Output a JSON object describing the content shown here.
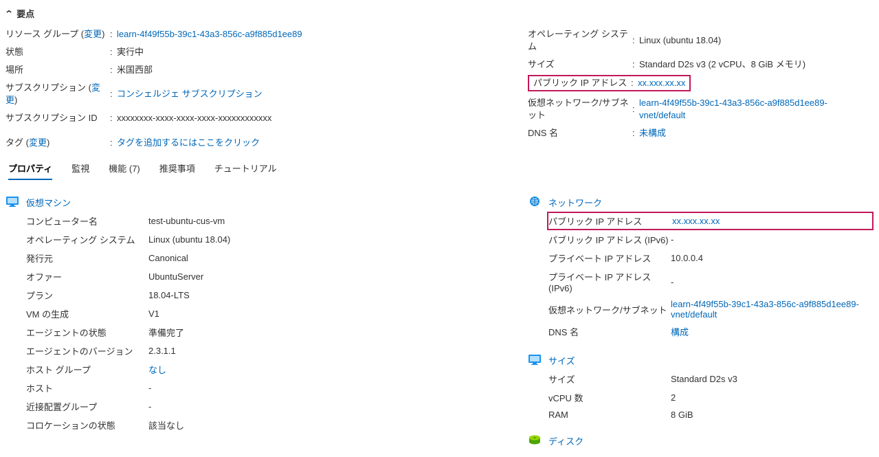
{
  "essentials_title": "要点",
  "change_text": "変更",
  "essentials": {
    "left": {
      "resource_group_label": "リソース グループ (",
      "resource_group_value": "learn-4f49f55b-39c1-43a3-856c-a9f885d1ee89",
      "status_label": "状態",
      "status_value": "実行中",
      "location_label": "場所",
      "location_value": "米国西部",
      "subscription_label": "サブスクリプション (",
      "subscription_value": "コンシェルジェ サブスクリプション",
      "subscription_id_label": "サブスクリプション ID",
      "subscription_id_value": "xxxxxxxx-xxxx-xxxx-xxxx-xxxxxxxxxxxx",
      "tags_label": "タグ (",
      "tags_value": "タグを追加するにはここをクリック"
    },
    "right": {
      "os_label": "オペレーティング システム",
      "os_value": "Linux (ubuntu 18.04)",
      "size_label": "サイズ",
      "size_value": "Standard D2s v3 (2 vCPU、8 GiB メモリ)",
      "public_ip_label": "パブリック IP アドレス",
      "public_ip_value": "xx.xxx.xx.xx",
      "vnet_label": "仮想ネットワーク/サブネット",
      "vnet_value": "learn-4f49f55b-39c1-43a3-856c-a9f885d1ee89-vnet/default",
      "dns_label": "DNS 名",
      "dns_value": "未構成"
    }
  },
  "tabs": {
    "properties": "プロパティ",
    "monitoring": "監視",
    "capabilities": "機能 (7)",
    "recommendations": "推奨事項",
    "tutorials": "チュートリアル"
  },
  "sections": {
    "vm": {
      "title": "仮想マシン",
      "rows": {
        "computer_name_label": "コンピューター名",
        "computer_name_value": "test-ubuntu-cus-vm",
        "os_label": "オペレーティング システム",
        "os_value": "Linux (ubuntu 18.04)",
        "publisher_label": "発行元",
        "publisher_value": "Canonical",
        "offer_label": "オファー",
        "offer_value": "UbuntuServer",
        "plan_label": "プラン",
        "plan_value": "18.04-LTS",
        "vm_gen_label": "VM の生成",
        "vm_gen_value": "V1",
        "agent_status_label": "エージェントの状態",
        "agent_status_value": "準備完了",
        "agent_version_label": "エージェントのバージョン",
        "agent_version_value": "2.3.1.1",
        "host_group_label": "ホスト グループ",
        "host_group_value": "なし",
        "host_label": "ホスト",
        "host_value": "-",
        "ppg_label": "近接配置グループ",
        "ppg_value": "-",
        "colocation_label": "コロケーションの状態",
        "colocation_value": "該当なし"
      }
    },
    "network": {
      "title": "ネットワーク",
      "rows": {
        "public_ip_label": "パブリック IP アドレス",
        "public_ip_value": "xx.xxx.xx.xx",
        "public_ip_v6_label": "パブリック IP アドレス (IPv6)",
        "public_ip_v6_value": "-",
        "private_ip_label": "プライベート IP アドレス",
        "private_ip_value": "10.0.0.4",
        "private_ip_v6_label": "プライベート IP アドレス (IPv6)",
        "private_ip_v6_value": "-",
        "vnet_label": "仮想ネットワーク/サブネット",
        "vnet_value": "learn-4f49f55b-39c1-43a3-856c-a9f885d1ee89-vnet/default",
        "dns_label": "DNS 名",
        "dns_value": "構成"
      }
    },
    "size": {
      "title": "サイズ",
      "rows": {
        "size_label": "サイズ",
        "size_value": "Standard D2s v3",
        "vcpu_label": "vCPU 数",
        "vcpu_value": "2",
        "ram_label": "RAM",
        "ram_value": "8 GiB"
      }
    },
    "disk": {
      "title": "ディスク"
    }
  }
}
